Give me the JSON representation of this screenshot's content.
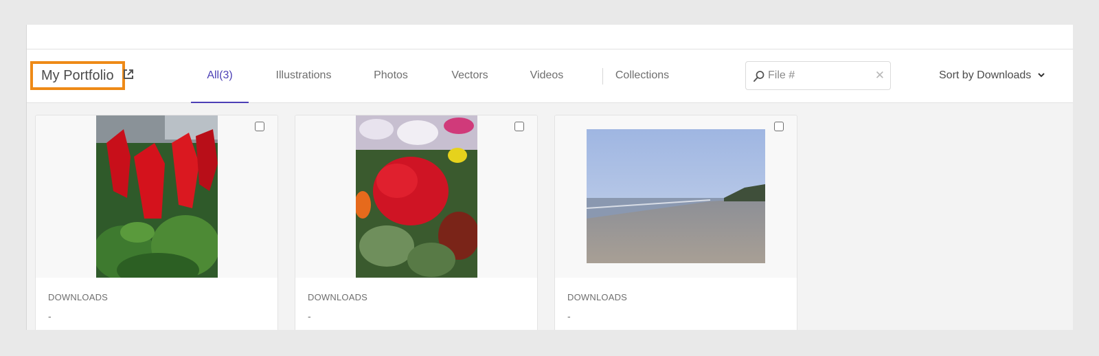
{
  "header": {
    "portfolio_title": "My Portfolio",
    "tabs": [
      {
        "label": "All(3)",
        "active": true
      },
      {
        "label": "Illustrations",
        "active": false
      },
      {
        "label": "Photos",
        "active": false
      },
      {
        "label": "Vectors",
        "active": false
      },
      {
        "label": "Videos",
        "active": false
      },
      {
        "label": "Collections",
        "active": false
      }
    ],
    "search": {
      "placeholder": "File #",
      "value": ""
    },
    "sort_label": "Sort by Downloads"
  },
  "cards": [
    {
      "image": "red salvia flowers photo",
      "downloads_label": "DOWNLOADS",
      "downloads_value": "-"
    },
    {
      "image": "red geranium flowers photo",
      "downloads_label": "DOWNLOADS",
      "downloads_value": "-"
    },
    {
      "image": "beach seascape photo",
      "downloads_label": "DOWNLOADS",
      "downloads_value": "-"
    }
  ],
  "colors": {
    "accent": "#4b3fb5",
    "highlight_border": "#ee8a17"
  }
}
